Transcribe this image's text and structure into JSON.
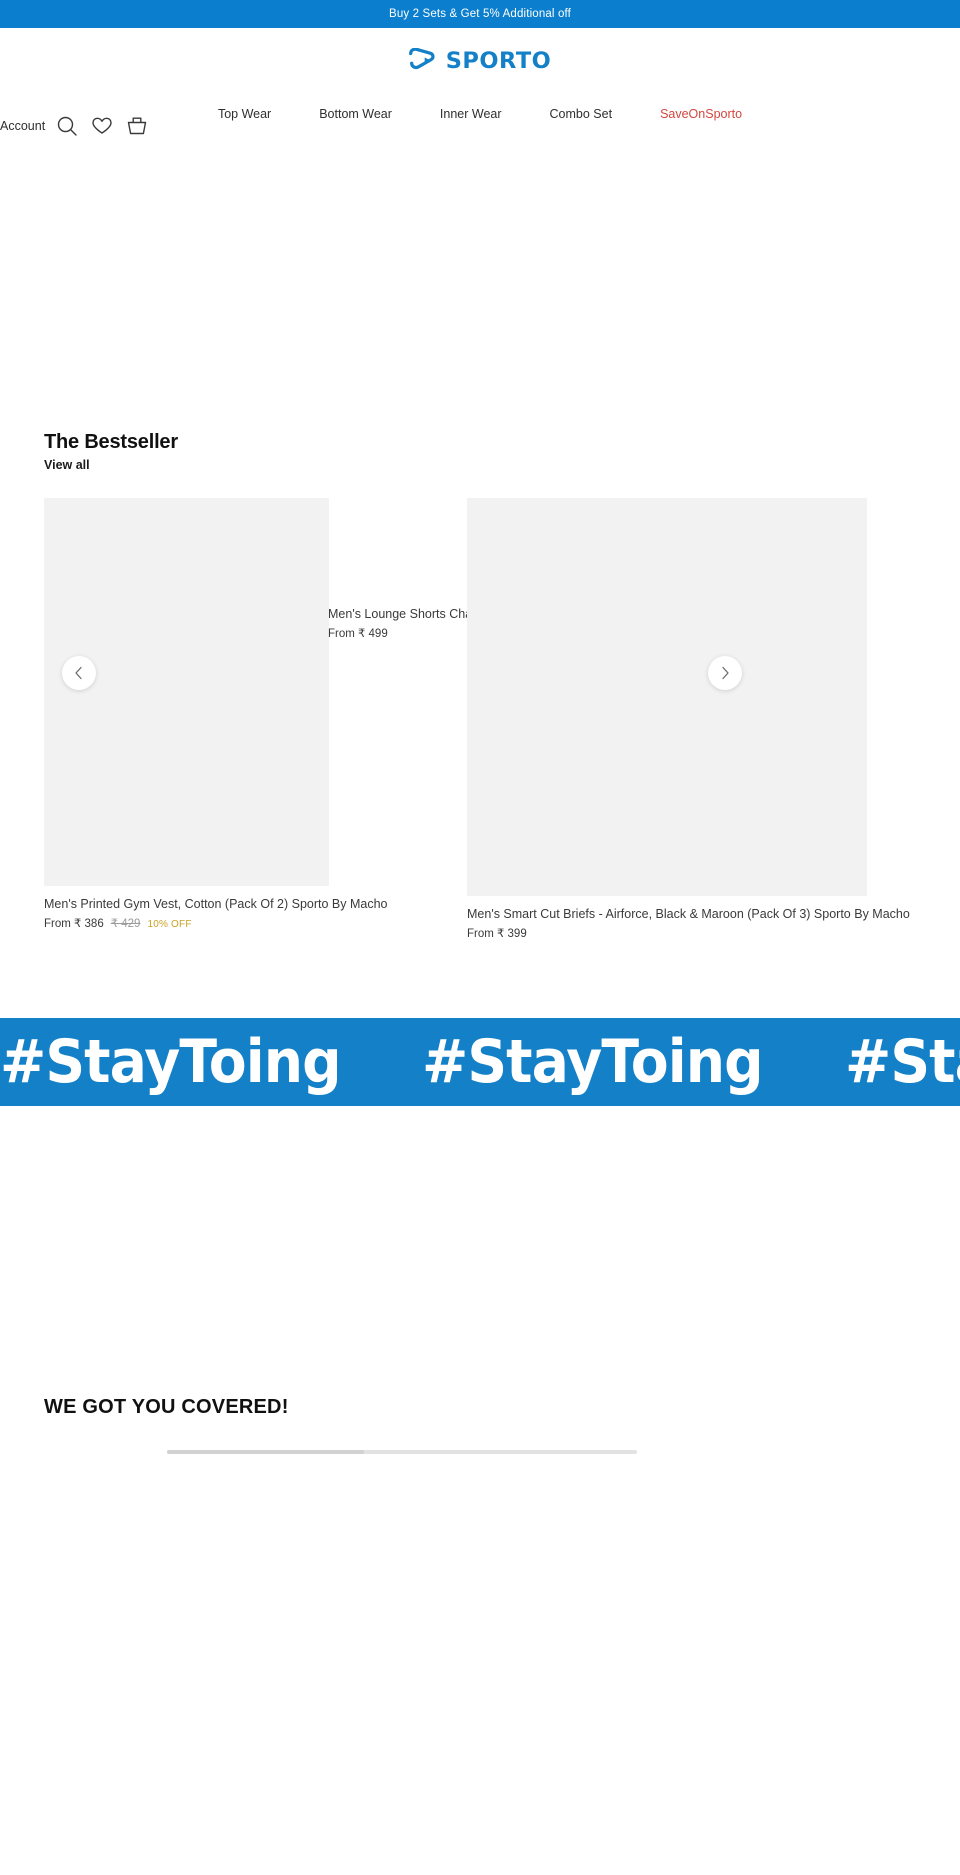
{
  "announcement": {
    "text": "Buy 2 Sets & Get 5% Additional off",
    "bg_color": "#0b7fcd"
  },
  "header": {
    "logo_text": "SPORTO",
    "logo_color": "#1380c8",
    "account_label": "Account",
    "icons": {
      "search": "search-icon",
      "wishlist": "heart-icon",
      "cart": "cart-icon"
    },
    "nav": [
      {
        "label": "Top Wear",
        "highlight": false
      },
      {
        "label": "Bottom Wear",
        "highlight": false
      },
      {
        "label": "Inner Wear",
        "highlight": false
      },
      {
        "label": "Combo Set",
        "highlight": false
      },
      {
        "label": "SaveOnSporto",
        "highlight": true
      }
    ],
    "sale_color": "#d1483f"
  },
  "bestseller": {
    "title": "The Bestseller",
    "view_all": "View all",
    "prev_label": "‹",
    "next_label": "›",
    "products": [
      {
        "title": "Men's Printed Gym Vest, Cotton (Pack Of 2) Sporto By Macho",
        "price": "From ₹ 386",
        "compare_at": "₹ 429",
        "discount": "10% OFF"
      },
      {
        "title": "Men's Lounge Shorts Charcoal",
        "price": "From ₹ 499",
        "compare_at": "",
        "discount": ""
      },
      {
        "title": "Men's Smart Cut Briefs - Airforce, Black & Maroon (Pack Of 3) Sporto By Macho",
        "price": "From ₹ 399",
        "compare_at": "",
        "discount": ""
      }
    ]
  },
  "marquee": {
    "text": "#StayToing",
    "repeat_1": "#StayToing",
    "repeat_2": "#StayToing",
    "repeat_3": "#StayToing",
    "bg_color": "#1380c8"
  },
  "covered": {
    "title": "WE GOT YOU COVERED!"
  }
}
